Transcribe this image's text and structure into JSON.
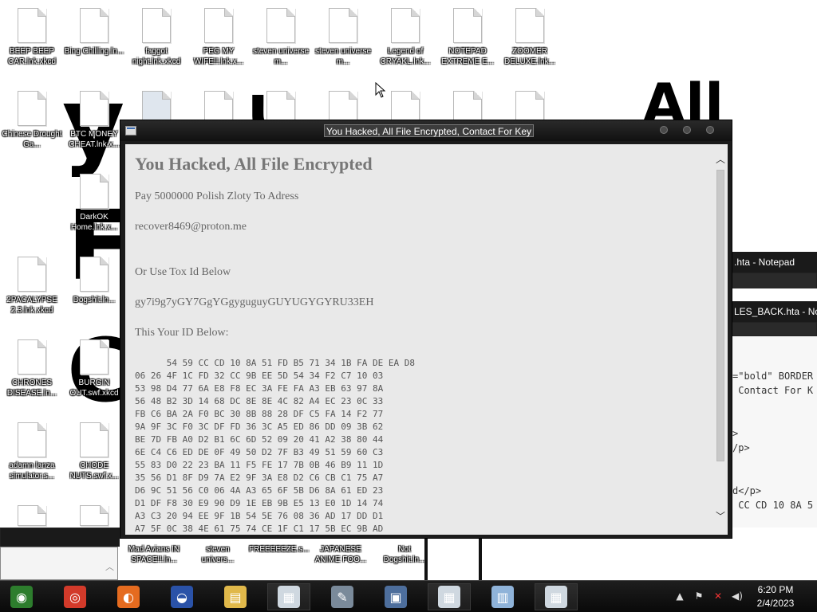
{
  "desktop_icons": [
    {
      "label": "BEEP BEEP CAR.lnk.xkcd"
    },
    {
      "label": "Bing Chilling.ln..."
    },
    {
      "label": "faggot night.lnk.xkcd"
    },
    {
      "label": "PEG MY WIFE!!.lnk.x..."
    },
    {
      "label": "steven universe m..."
    },
    {
      "label": "steven universe m..."
    },
    {
      "label": "Legend of CRYAKL.lnk..."
    },
    {
      "label": "NOTEPAD EXTREME E..."
    },
    {
      "label": "ZOOMER DELUXE.lnk..."
    },
    {
      "label": "Chinese Drought Ga..."
    },
    {
      "label": "BTC MONEY CHEAT.lnk.x..."
    },
    {
      "label": "DarkOK Home.lnk.x..."
    },
    {
      "label": "2PACALYPSE 2.3.lnk.xkcd"
    },
    {
      "label": "Dogshit.ln..."
    },
    {
      "label": "CHRONES DISEASE.ln..."
    },
    {
      "label": "BURGIN OUT.swf.xkcd"
    },
    {
      "label": "adamn lanza simulator.s..."
    },
    {
      "label": "CHODE NUTS.swf.x..."
    }
  ],
  "bottom_icons": [
    {
      "label": "Mad Avians IN SPACE!!.ln..."
    },
    {
      "label": "steven univers..."
    },
    {
      "label": "FREEEEEZE.s..."
    },
    {
      "label": "JAPANESE ANIME FOO..."
    },
    {
      "label": "Not Dogshit.ln..."
    }
  ],
  "glyphs": {
    "y": "y",
    "f": "F",
    "c": "C",
    "u": "u",
    "all": "All"
  },
  "background_windows": {
    "notepad1_title": ".hta - Notepad",
    "notepad2_title": "LES_BACK.hta - No",
    "code_lines": [
      "=\"bold\" BORDER",
      " Contact For K",
      "",
      ">",
      "/p>",
      "",
      "",
      "d</p>",
      " CC CD 10 8A 5"
    ]
  },
  "window": {
    "title": "You Hacked, All File Encrypted, Contact For Key",
    "heading": "You Hacked, All File Encrypted",
    "pay_line": "Pay 5000000 Polish Zloty To Adress",
    "email": "recover8469@proton.me",
    "tox_intro": "Or Use Tox Id Below",
    "tox_id": "gy7i9g7yGY7GgYGgyguguyGUYUGYGYRU33EH",
    "id_intro": "This Your ID Below:",
    "id_hex": "      54 59 CC CD 10 8A 51 FD B5 71 34 1B FA DE EA D8\n06 26 4F 1C FD 32 CC 9B EE 5D 54 34 F2 C7 10 03\n53 98 D4 77 6A E8 F8 EC 3A FE FA A3 EB 63 97 8A\n56 48 B2 3D 14 68 DC 8E 8E 4C 82 A4 EC 23 0C 33\nFB C6 BA 2A F0 BC 30 8B 88 28 DF C5 FA 14 F2 77\n9A 9F 3C F0 3C DF FD 36 3C A5 ED 86 DD 09 3B 62\nBE 7D FB A0 D2 B1 6C 6D 52 09 20 41 A2 38 80 44\n6E C4 C6 ED DE 0F 49 50 D2 7F B3 49 51 59 60 C3\n55 83 D0 22 23 BA 11 F5 FE 17 7B 0B 46 B9 11 1D\n35 56 D1 8F D9 7A E2 9F 3A E8 D2 C6 CB C1 75 A7\nD6 9C 51 56 C0 06 4A A3 65 6F 5B D6 8A 61 ED 23\nD1 DF F8 30 E9 90 D9 1E EB 9B E5 13 E0 1D 14 74\nA3 C3 20 94 EE 9F 1B 54 5E 76 08 36 AD 17 DD D1\nA7 5F 0C 38 4E 61 75 74 CE 1F C1 17 5B EC 9B AD"
  },
  "taskbar": {
    "items": [
      {
        "icon": "start-orb-icon",
        "color": "#2d7d2d",
        "glyph": "◉"
      },
      {
        "icon": "chrome-icon",
        "color": "#d23a2a",
        "glyph": "◎"
      },
      {
        "icon": "firefox-icon",
        "color": "#e56b1f",
        "glyph": "◐"
      },
      {
        "icon": "obama-logo-icon",
        "color": "#2a52a8",
        "glyph": "◒"
      },
      {
        "icon": "file-explorer-icon",
        "color": "#e0b84a",
        "glyph": "▤"
      },
      {
        "icon": "hta-window-icon",
        "color": "#cfd8e0",
        "glyph": "▦"
      },
      {
        "icon": "paint-icon",
        "color": "#7a8a9a",
        "glyph": "✎"
      },
      {
        "icon": "network-computer-icon",
        "color": "#4d6e9c",
        "glyph": "▣"
      },
      {
        "icon": "hta-window-icon-2",
        "color": "#cfd8e0",
        "glyph": "▦"
      },
      {
        "icon": "notepad-icon",
        "color": "#8fb3d9",
        "glyph": "▥"
      },
      {
        "icon": "hta-window-icon-3",
        "color": "#cfd8e0",
        "glyph": "▦"
      }
    ],
    "clock_time": "6:20 PM",
    "clock_date": "2/4/2023"
  }
}
